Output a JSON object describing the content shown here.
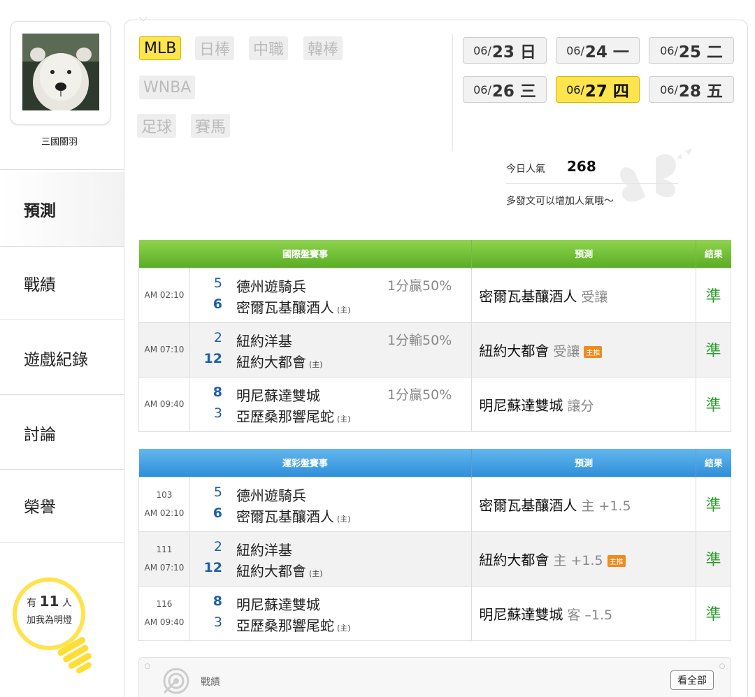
{
  "user": {
    "name": "三國關羽"
  },
  "nav": {
    "items": [
      {
        "label": "預測",
        "active": true
      },
      {
        "label": "戰績"
      },
      {
        "label": "遊戲紀錄"
      },
      {
        "label": "討論"
      },
      {
        "label": "榮譽"
      }
    ]
  },
  "fans": {
    "prefix": "有",
    "count": "11",
    "suffix": "人",
    "line2": "加我為明燈"
  },
  "leagues": [
    {
      "label": "MLB",
      "active": true
    },
    {
      "label": "日棒"
    },
    {
      "label": "中職"
    },
    {
      "label": "韓棒"
    },
    {
      "label": "WNBA"
    },
    {
      "label": "足球"
    },
    {
      "label": "賽馬"
    }
  ],
  "dates": [
    {
      "md": "06/",
      "day": "23 日"
    },
    {
      "md": "06/",
      "day": "24 一"
    },
    {
      "md": "06/",
      "day": "25 二"
    },
    {
      "md": "06/",
      "day": "26 三"
    },
    {
      "md": "06/",
      "day": "27 四",
      "active": true
    },
    {
      "md": "06/",
      "day": "28 五"
    }
  ],
  "popularity": {
    "label": "今日人氣",
    "value": "268",
    "note": "多發文可以增加人氣哦～"
  },
  "international": {
    "headers": [
      "國際盤賽事",
      "預測",
      "結果"
    ],
    "rows": [
      {
        "time": "AM 02:10",
        "s1": "5",
        "t1": "德州遊騎兵",
        "s2": "6",
        "t2": "密爾瓦基釀酒人",
        "host": "(主)",
        "line": "1分贏50%",
        "pred": "密爾瓦基釀酒人",
        "side": "受讓",
        "badge": "",
        "result": "準"
      },
      {
        "time": "AM 07:10",
        "s1": "2",
        "t1": "紐約洋基",
        "s2": "12",
        "t2": "紐約大都會",
        "host": "(主)",
        "line": "1分輸50%",
        "pred": "紐約大都會",
        "side": "受讓",
        "badge": "主推",
        "result": "準"
      },
      {
        "time": "AM 09:40",
        "s1": "8",
        "t1": "明尼蘇達雙城",
        "s2": "3",
        "t2": "亞歷桑那響尾蛇",
        "host": "(主)",
        "line": "1分贏50%",
        "pred": "明尼蘇達雙城",
        "side": "讓分",
        "badge": "",
        "result": "準"
      }
    ]
  },
  "lottery": {
    "headers": [
      "運彩盤賽事",
      "預測",
      "結果"
    ],
    "rows": [
      {
        "no": "103",
        "time": "AM 02:10",
        "s1": "5",
        "t1": "德州遊騎兵",
        "s2": "6",
        "t2": "密爾瓦基釀酒人",
        "host": "(主)",
        "pred": "密爾瓦基釀酒人",
        "side": "主 +1.5",
        "badge": "",
        "result": "準"
      },
      {
        "no": "111",
        "time": "AM 07:10",
        "s1": "2",
        "t1": "紐約洋基",
        "s2": "12",
        "t2": "紐約大都會",
        "host": "(主)",
        "pred": "紐約大都會",
        "side": "主 +1.5",
        "badge": "主推",
        "result": "準"
      },
      {
        "no": "116",
        "time": "AM 09:40",
        "s1": "8",
        "t1": "明尼蘇達雙城",
        "s2": "3",
        "t2": "亞歷桑那響尾蛇",
        "host": "(主)",
        "pred": "明尼蘇達雙城",
        "side": "客 –1.5",
        "badge": "",
        "result": "準"
      }
    ]
  },
  "record": {
    "label": "戰績",
    "view_all": "看全部"
  },
  "icons": {
    "avatar": "polar-bear-photo",
    "bulb": "light-bulb-icon",
    "record": "target-icon",
    "deco": "butterfly-decoration"
  },
  "colors": {
    "active_tab": "#ffe54d",
    "green_header": "#5aad24",
    "blue_header": "#2f8fd9",
    "result_green": "#2a9d2a",
    "score_blue": "#1f5fa8",
    "badge": "#f28a1c"
  }
}
